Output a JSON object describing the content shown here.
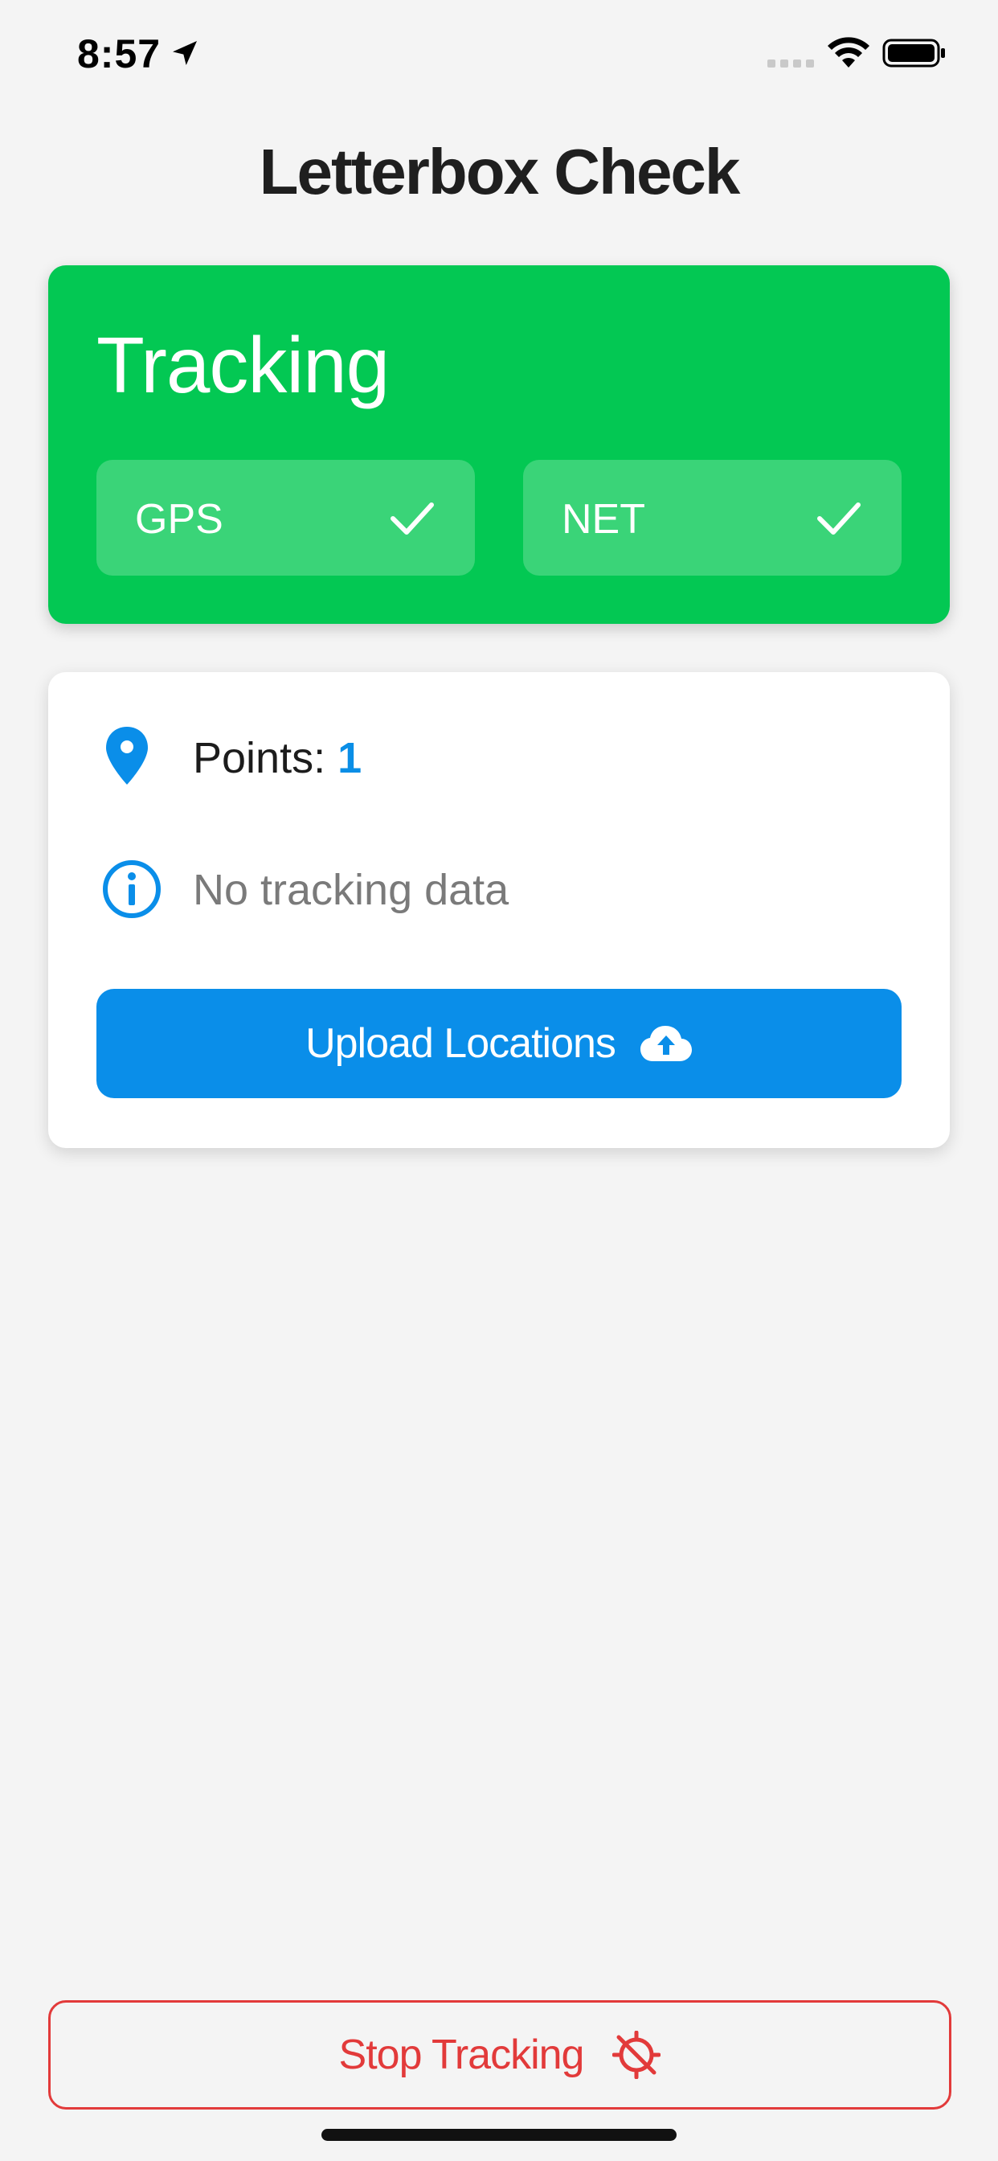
{
  "status_bar": {
    "time": "8:57",
    "icons": [
      "location-arrow-icon",
      "cellular-signal-icon",
      "wifi-icon",
      "battery-icon"
    ]
  },
  "header": {
    "title": "Letterbox Check"
  },
  "tracking_card": {
    "status": "Tracking",
    "color": "#03c853",
    "indicators": [
      {
        "label": "GPS",
        "state": "ok",
        "icon": "checkmark-icon"
      },
      {
        "label": "NET",
        "state": "ok",
        "icon": "checkmark-icon"
      }
    ]
  },
  "info_card": {
    "points_label": "Points:",
    "points_value": "1",
    "message": "No tracking data",
    "upload_label": "Upload Locations",
    "accent": "#0a8ee9"
  },
  "footer": {
    "stop_label": "Stop Tracking",
    "stop_color": "#e23a3a"
  }
}
